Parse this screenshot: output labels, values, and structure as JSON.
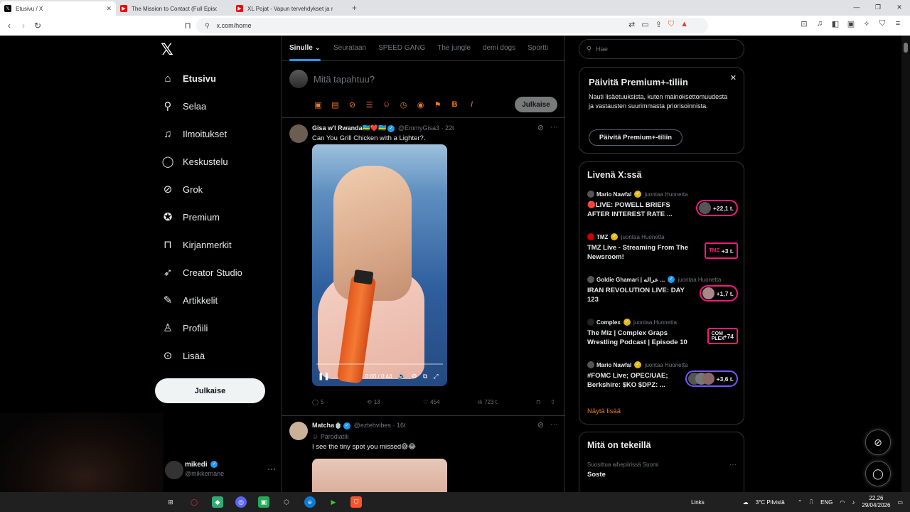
{
  "browser": {
    "tabs": [
      {
        "title": "Etusivu / X",
        "active": true
      },
      {
        "title": "The Mission to Contact (Full Episode",
        "active": false
      },
      {
        "title": "XL Pojat - Vapun tervehdykset ja muut",
        "active": false
      }
    ],
    "url": "x.com/home"
  },
  "nav": {
    "items": [
      {
        "label": "Etusivu",
        "icon": "home-icon"
      },
      {
        "label": "Selaa",
        "icon": "search-icon"
      },
      {
        "label": "Ilmoitukset",
        "icon": "bell-icon"
      },
      {
        "label": "Keskustelu",
        "icon": "chat-icon"
      },
      {
        "label": "Grok",
        "icon": "grok-icon"
      },
      {
        "label": "Premium",
        "icon": "premium-icon"
      },
      {
        "label": "Kirjanmerkit",
        "icon": "bookmark-icon"
      },
      {
        "label": "Creator Studio",
        "icon": "rocket-icon"
      },
      {
        "label": "Artikkelit",
        "icon": "article-icon"
      },
      {
        "label": "Profiili",
        "icon": "profile-icon"
      },
      {
        "label": "Lisää",
        "icon": "more-icon"
      }
    ],
    "post_button": "Julkaise",
    "account": {
      "name": "mikedi",
      "handle": "@mikkemane"
    }
  },
  "feed": {
    "tabs": [
      "Sinulle",
      "Seurataan",
      "SPEED GANG",
      "The jungle",
      "demi dogs",
      "Sportti"
    ],
    "compose_placeholder": "Mitä tapahtuu?",
    "compose_button": "Julkaise",
    "tweets": [
      {
        "name": "Gisa w'l Rwanda",
        "flags": "🇷🇼❤️🇷🇼",
        "handle": "@EmmyGisa3",
        "time": "22t",
        "text": "Can You Grill Chicken with a Lighter?.",
        "video_time": "0:00 / 0:44",
        "replies": "5",
        "reposts": "13",
        "likes": "454",
        "views": "723 t."
      },
      {
        "name": "Matcha",
        "flags": "🍵",
        "handle": "@eztehvibes",
        "time": "16t",
        "label": "Parodiatili",
        "text": "I see the tiny spot you missed😅😂"
      }
    ]
  },
  "sidebar": {
    "search_placeholder": "Hae",
    "premium": {
      "title": "Päivitä Premium+-tiliin",
      "description": "Nauti lisäetuuksista, kuten mainoksettomuudesta ja vastausten suurimmasta priorisoinnista.",
      "button": "Päivitä Premium+-tiliin"
    },
    "live": {
      "title": "Livenä X:ssä",
      "items": [
        {
          "host": "Mario Nawfal",
          "role": "juontaa Huonetta",
          "title": "🔴LIVE: POWELL BRIEFS AFTER INTEREST RATE ...",
          "count": "+22,1 t.",
          "style": "pink"
        },
        {
          "host": "TMZ",
          "role": "juontaa Huonetta",
          "title": "TMZ Live - Streaming From The Newsroom!",
          "count": "+3 t.",
          "logo": "TMZ",
          "style": "pink-sq"
        },
        {
          "host": "Goldie Ghamari | غزاله ...",
          "role": "juontaa Huonetta",
          "title": "IRAN REVOLUTION LIVE: DAY 123",
          "count": "+1,7 t.",
          "style": "pink"
        },
        {
          "host": "Complex",
          "role": "juontaa Huonetta",
          "title": "The Miz | Complex Graps Wrestling Podcast | Episode 10",
          "count": "+74",
          "logo": "COM PLEX",
          "style": "pink-sq"
        },
        {
          "host": "Mario Nawfal",
          "role": "juontaa Huonetta",
          "title": "#FOMC Live; OPEC/UAE; Berkshire: $KO $DPZ: ...",
          "count": "+3,6 t.",
          "style": "purple"
        }
      ],
      "more": "Näytä lisää"
    },
    "happening": {
      "title": "Mitä on tekeillä",
      "subtitle": "Suosittua aihepiirissä Suomi",
      "topic": "Soste"
    }
  },
  "taskbar": {
    "links": "Links",
    "weather": "3°C  Pilvistä",
    "lang": "ENG",
    "time": "22.26",
    "date": "29/04/2026"
  }
}
